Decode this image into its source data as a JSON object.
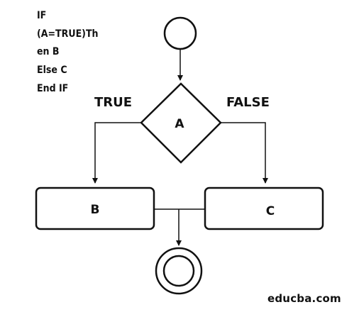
{
  "pseudocode": {
    "lines": [
      "IF",
      "(A=TRUE)Th",
      "en B",
      "Else C",
      "End IF"
    ]
  },
  "diagram": {
    "decision_label": "A",
    "true_label": "TRUE",
    "false_label": "FALSE",
    "box_b_label": "B",
    "box_c_label": "C"
  },
  "watermark": "educba.com"
}
